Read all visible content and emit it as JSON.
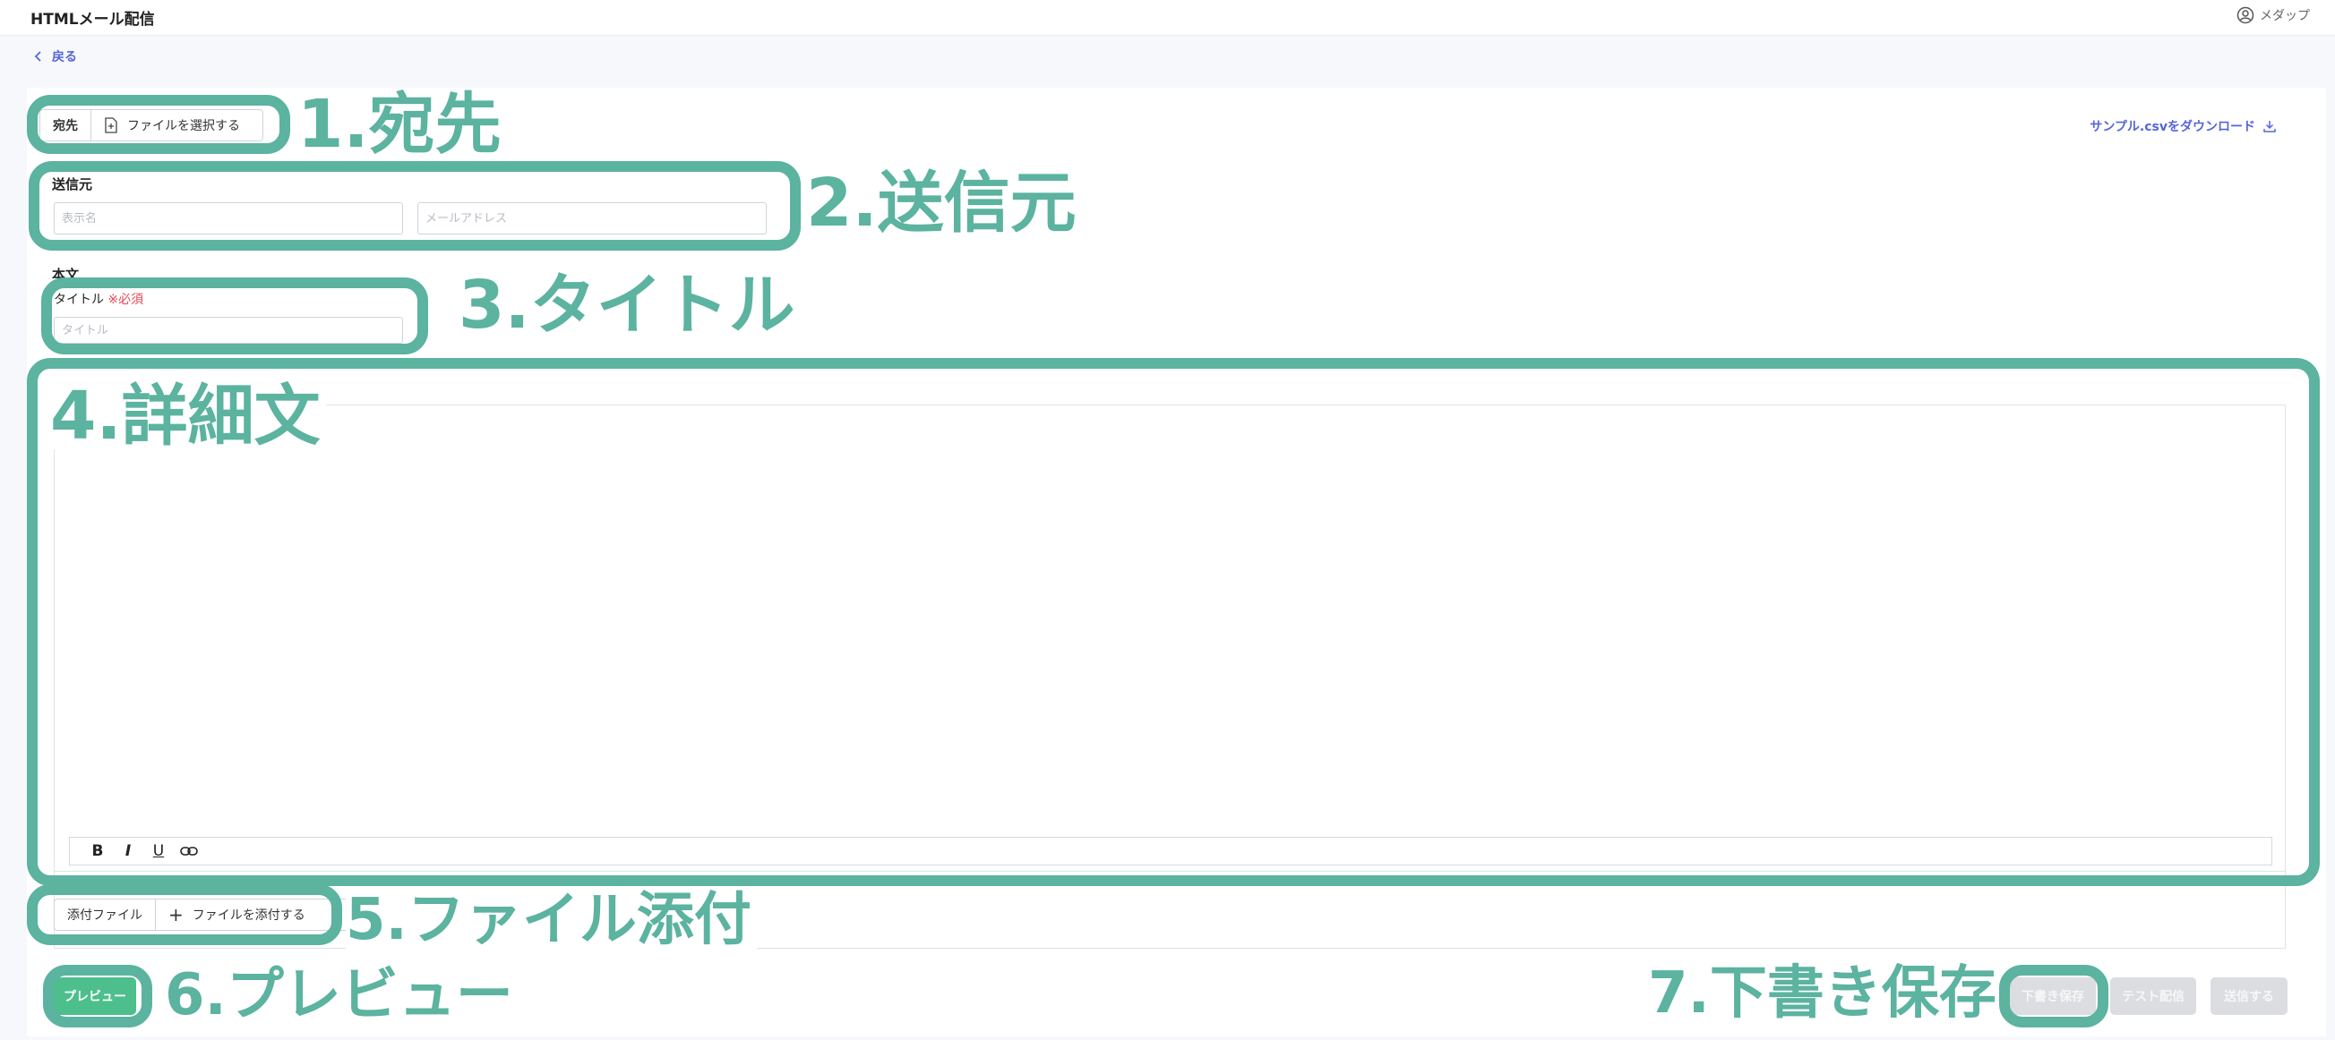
{
  "app": {
    "title": "HTMLメール配信",
    "user": "メダップ"
  },
  "nav": {
    "back_label": "戻る"
  },
  "recipient": {
    "label": "宛先",
    "select_file": "ファイルを選択する",
    "download_sample": "サンプル.csvをダウンロード"
  },
  "sender": {
    "label": "送信元",
    "name_placeholder": "表示名",
    "email_placeholder": "メールアドレス"
  },
  "body": {
    "label": "本文",
    "title_label": "タイトル",
    "required": "※必須",
    "title_placeholder": "タイトル"
  },
  "toolbar": {
    "bold": "B",
    "italic": "I",
    "underline": "U"
  },
  "attachment": {
    "label": "添付ファイル",
    "attach": "ファイルを添付する"
  },
  "actions": {
    "preview": "プレビュー",
    "save_draft": "下書き保存",
    "test_send": "テスト配信",
    "send": "送信する"
  },
  "annotations": {
    "a1": "1.宛先",
    "a2": "2.送信元",
    "a3": "3.タイトル",
    "a4": "4.詳細文",
    "a5": "5.ファイル添付",
    "a6": "6.プレビュー",
    "a7": "7.下書き保存"
  },
  "colors": {
    "annotation": "#5bb3a0",
    "accent_link": "#5566d8",
    "preview_button": "#4dbf8c",
    "required": "#e24a5a"
  }
}
